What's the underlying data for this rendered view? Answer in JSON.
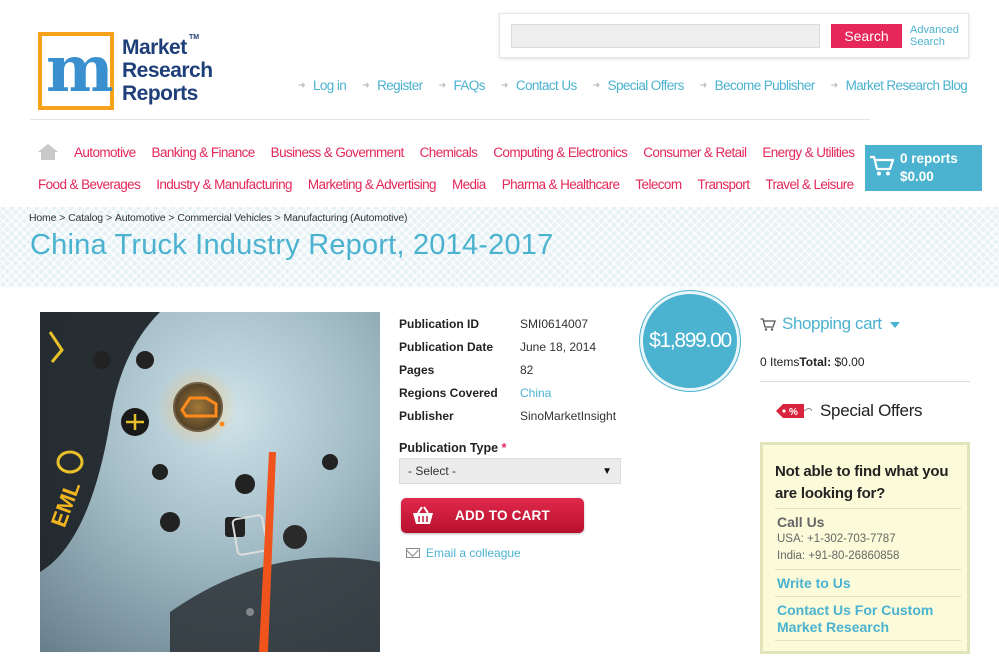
{
  "header": {
    "logo_lines": [
      "Market",
      "Research",
      "Reports"
    ],
    "logo_tm": "TM",
    "search": {
      "placeholder": "",
      "button_label": "Search",
      "advanced_label": "Advanced Search"
    },
    "top_nav": [
      "Log in",
      "Register",
      "FAQs",
      "Contact Us",
      "Special Offers",
      "Become Publisher",
      "Market Research Blog"
    ]
  },
  "categories": {
    "row1": [
      "Automotive",
      "Banking & Finance",
      "Business & Government",
      "Chemicals",
      "Computing & Electronics",
      "Consumer & Retail",
      "Energy & Utilities"
    ],
    "row2": [
      "Food & Beverages",
      "Industry & Manufacturing",
      "Marketing & Advertising",
      "Media",
      "Pharma & Healthcare",
      "Telecom",
      "Transport",
      "Travel & Leisure"
    ]
  },
  "cart_button": {
    "reports": "0 reports",
    "total": "$0.00"
  },
  "breadcrumb": [
    "Home",
    "Catalog",
    "Automotive",
    "Commercial Vehicles",
    "Manufacturing (Automotive)"
  ],
  "page_title": "China Truck Industry Report, 2014-2017",
  "details": [
    {
      "label": "Publication ID",
      "value": "SMI0614007"
    },
    {
      "label": "Publication Date",
      "value": "June 18, 2014"
    },
    {
      "label": "Pages",
      "value": "82"
    },
    {
      "label": "Regions Covered",
      "value": "China"
    },
    {
      "label": "Publisher",
      "value": "SinoMarketInsight"
    }
  ],
  "price": "$1,899.00",
  "publication_type": {
    "label": "Publication Type",
    "required_mark": "*",
    "selected": "- Select -"
  },
  "add_to_cart_label": "ADD TO CART",
  "email_colleague_label": "Email a colleague",
  "sidebar": {
    "shopping_cart_title": "Shopping cart",
    "items_label": "0 Items",
    "total_label": "Total:",
    "total_value": "$0.00",
    "special_offers": "Special Offers",
    "help_title": "Not able to find what you are looking for?",
    "call_us_title": "Call Us",
    "phone_usa": "USA: +1-302-703-7787",
    "phone_india": "India: +91-80-26860858",
    "write_to_us": "Write to Us",
    "contact_custom": "Contact Us For Custom Market Research"
  },
  "colors": {
    "accent_blue": "#4bb2d0",
    "accent_pink": "#e5275a",
    "logo_orange": "#f7a21b",
    "logo_navy": "#1f3f7a"
  }
}
